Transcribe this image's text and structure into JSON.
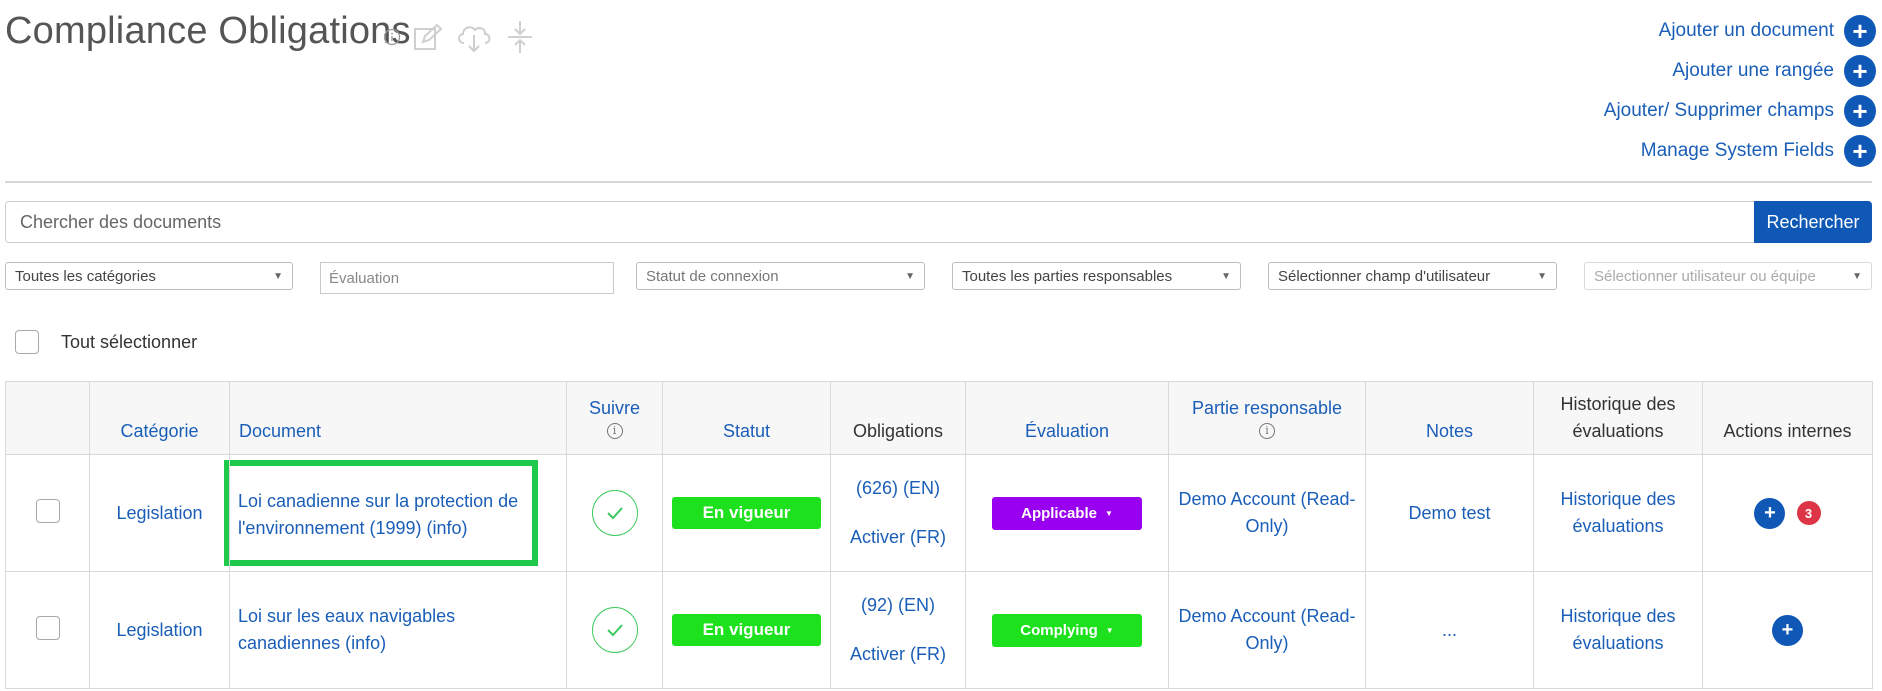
{
  "page": {
    "title": "Compliance Obligations"
  },
  "header_icons": [
    "info-icon",
    "edit-icon",
    "cloud-download-icon",
    "collapse-icon"
  ],
  "actions": [
    {
      "label": "Ajouter un document"
    },
    {
      "label": "Ajouter une rangée"
    },
    {
      "label": "Ajouter/ Supprimer champs"
    },
    {
      "label": "Manage System Fields"
    }
  ],
  "search": {
    "placeholder": "Chercher des documents",
    "button": "Rechercher"
  },
  "filters": {
    "categories": "Toutes les catégories",
    "evaluation_placeholder": "Évaluation",
    "connection_status": "Statut de connexion",
    "responsible_parties": "Toutes les parties responsables",
    "user_field": "Sélectionner champ d'utilisateur",
    "user_or_team": "Sélectionner utilisateur ou équipe"
  },
  "select_all": {
    "label": "Tout sélectionner"
  },
  "table": {
    "headers": {
      "category": "Catégorie",
      "document": "Document",
      "follow": "Suivre",
      "status": "Statut",
      "obligations": "Obligations",
      "evaluation": "Évaluation",
      "responsible": "Partie responsable",
      "notes": "Notes",
      "history": "Historique des évaluations",
      "internal_actions": "Actions internes"
    },
    "rows": [
      {
        "category": "Legislation",
        "document": "Loi canadienne sur la protection de l'environnement (1999) (info)",
        "status": "En vigueur",
        "obligations_en": "(626) (EN)",
        "obligations_fr": "Activer (FR)",
        "evaluation": "Applicable",
        "evaluation_color": "#9a00f0",
        "responsible": "Demo Account (Read-Only)",
        "notes": "Demo test",
        "history": "Historique des évaluations",
        "badge": "3",
        "highlighted": true
      },
      {
        "category": "Legislation",
        "document": "Loi sur les eaux navigables canadiennes (info)",
        "status": "En vigueur",
        "obligations_en": "(92) (EN)",
        "obligations_fr": "Activer (FR)",
        "evaluation": "Complying",
        "evaluation_color": "#1ce11c",
        "responsible": "Demo Account (Read-Only)",
        "notes": "...",
        "history": "Historique des évaluations",
        "badge": "",
        "highlighted": false
      }
    ]
  },
  "colors": {
    "accent": "#0f58b6",
    "link": "#1a5eb8",
    "status_green": "#1ce11c",
    "highlight_green": "#1ec94c",
    "badge_red": "#dc3545"
  }
}
